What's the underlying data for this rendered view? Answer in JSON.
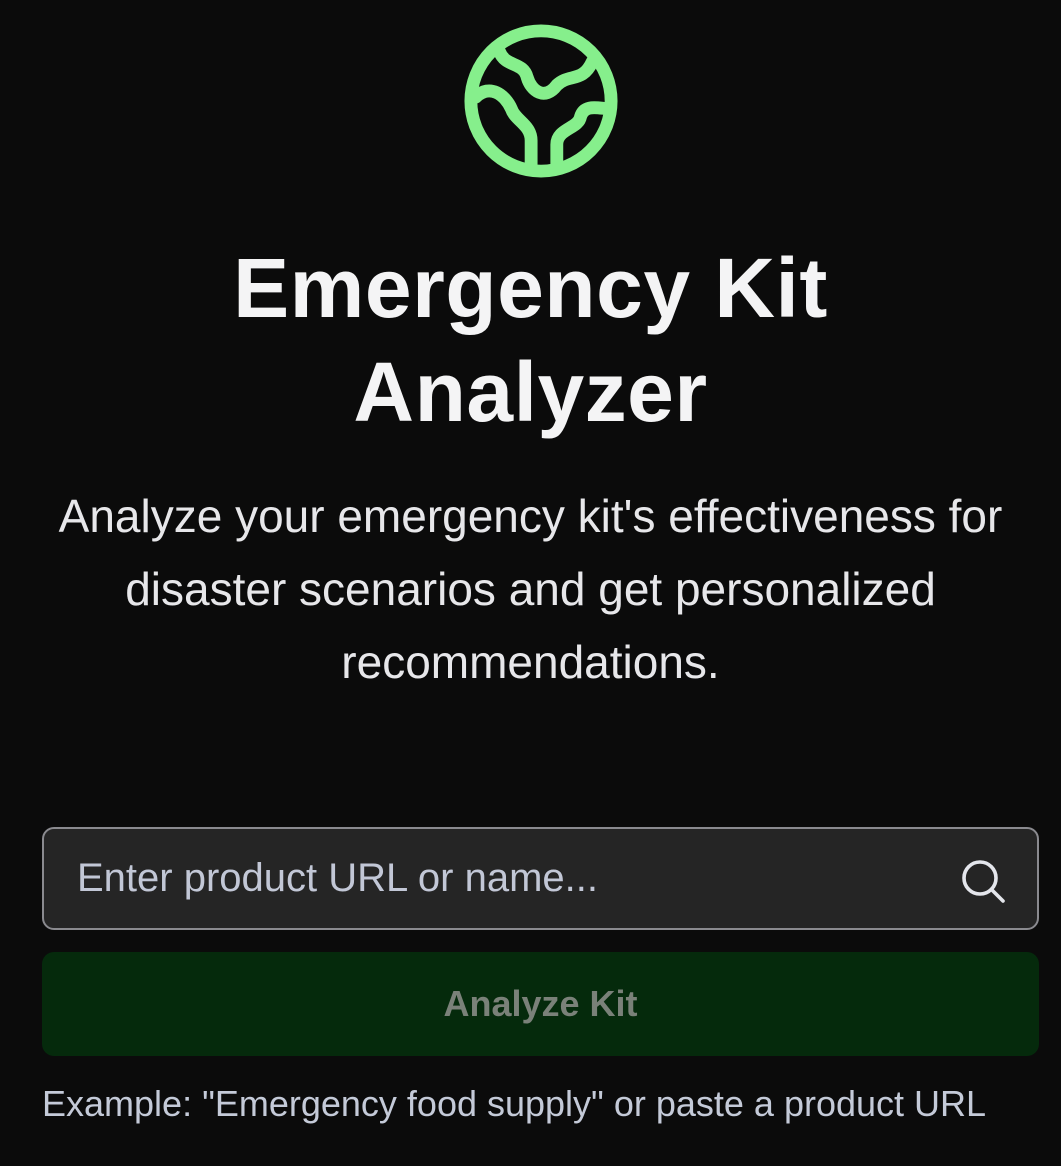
{
  "header": {
    "logo_icon": "globe-icon",
    "title_line1": "Emergency Kit",
    "title_line2": "Analyzer",
    "subtitle": "Analyze your emergency kit's effectiveness for disaster scenarios and get personalized recommendations."
  },
  "search": {
    "value": "",
    "placeholder": "Enter product URL or name...",
    "icon": "search-icon"
  },
  "actions": {
    "analyze_label": "Analyze Kit"
  },
  "help": {
    "example_text": "Example: \"Emergency food supply\" or paste a product URL"
  },
  "colors": {
    "background": "#0b0b0b",
    "accent": "#86ef8c",
    "button_bg": "#052a0c",
    "button_text": "#7a8179",
    "input_bg": "#252525",
    "input_border": "#8a8a8f"
  }
}
